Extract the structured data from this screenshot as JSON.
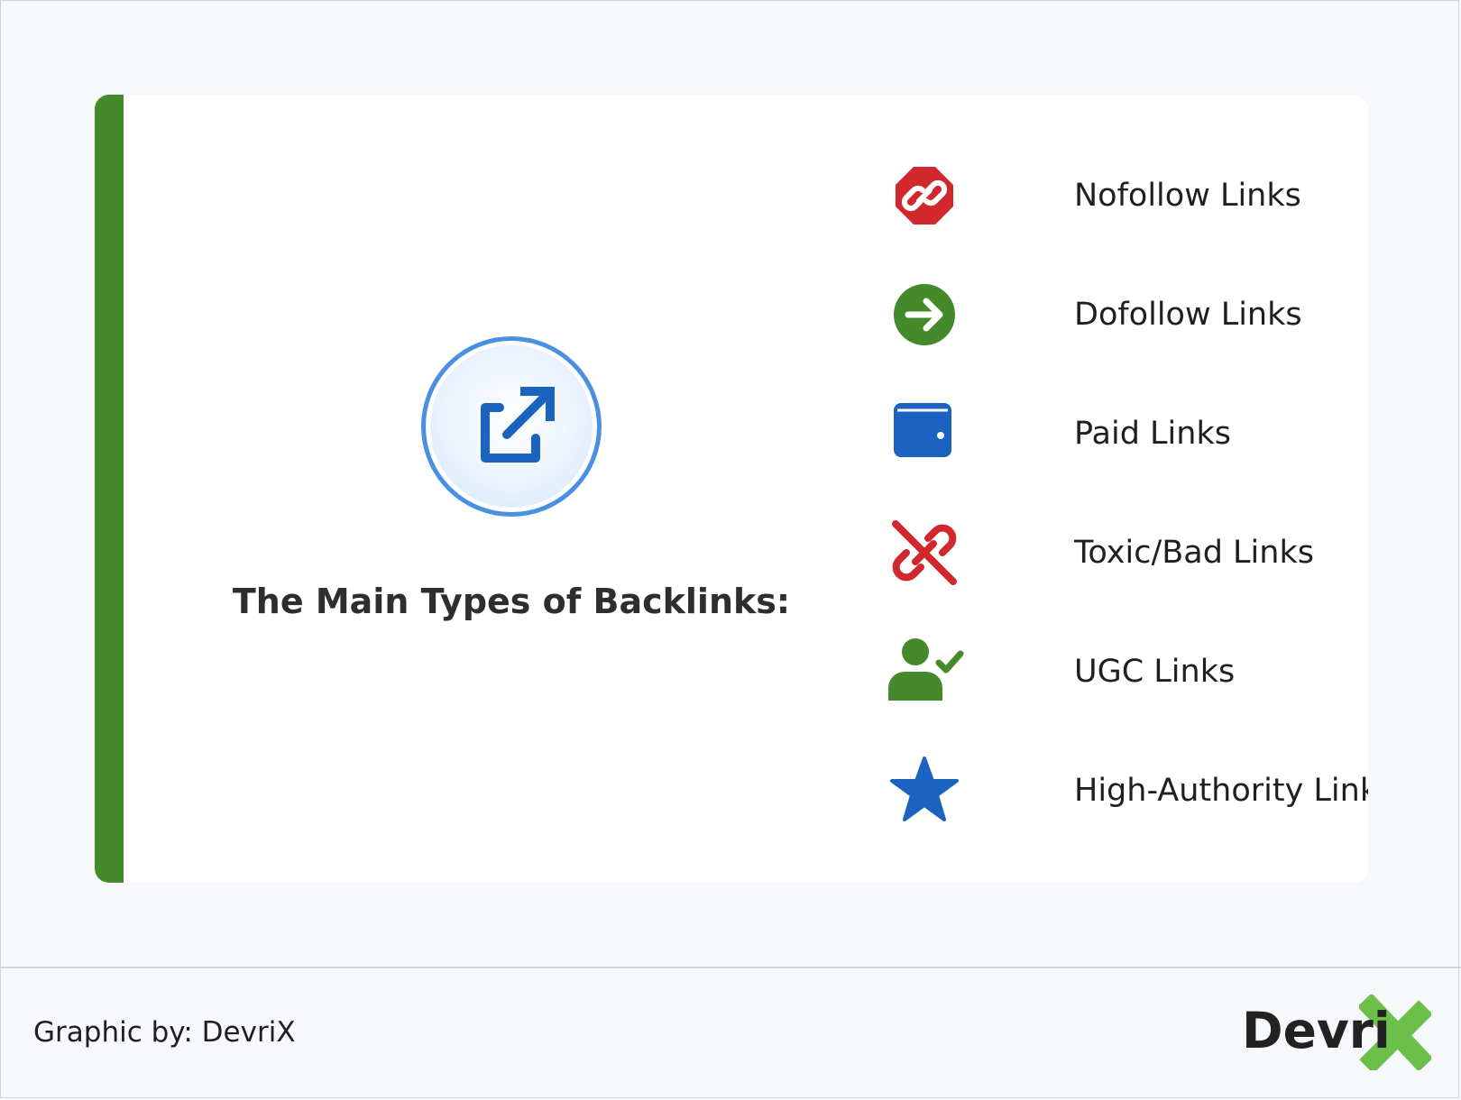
{
  "colors": {
    "background": "#f6f8fb",
    "card": "#ffffff",
    "accent_green": "#448a2a",
    "red": "#d0282c",
    "blue": "#1b63c0",
    "title_text": "#2e2e2e"
  },
  "hero": {
    "icon": "external-link-icon",
    "title": "The Main Types of Backlinks:"
  },
  "link_types": [
    {
      "icon": "link-octagon-icon",
      "label": "Nofollow Links"
    },
    {
      "icon": "arrow-circle-right-icon",
      "label": "Dofollow Links"
    },
    {
      "icon": "wallet-icon",
      "label": "Paid Links"
    },
    {
      "icon": "broken-link-icon",
      "label": "Toxic/Bad Links"
    },
    {
      "icon": "user-check-icon",
      "label": "UGC Links"
    },
    {
      "icon": "star-icon",
      "label": "High-Authority Links"
    }
  ],
  "footer": {
    "credit": "Graphic by: DevriX",
    "brand_text": "Devri",
    "brand_icon": "x-mark-logo-icon"
  }
}
